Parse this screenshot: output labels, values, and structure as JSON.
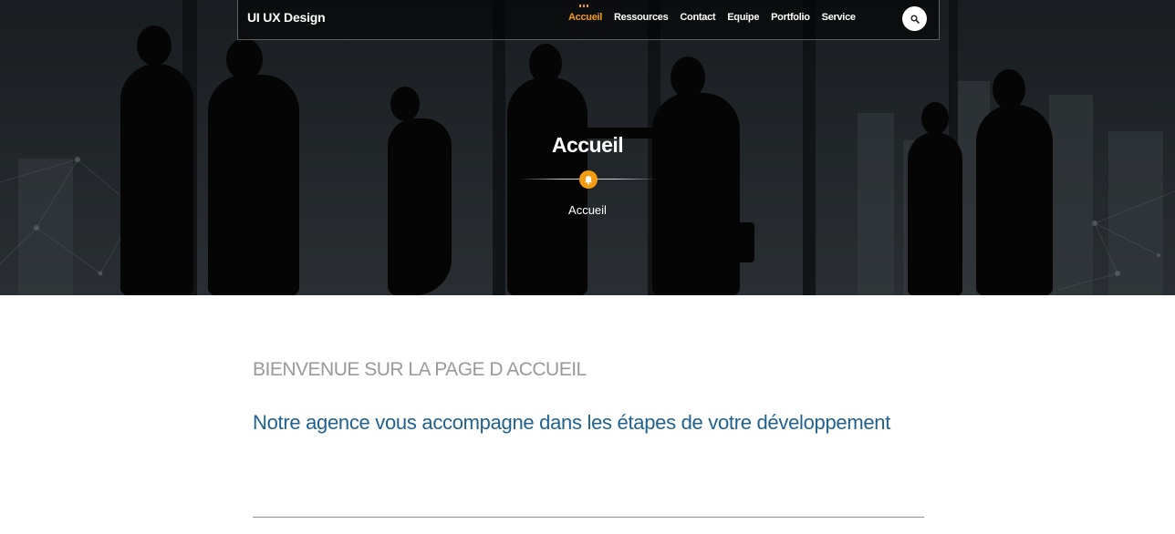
{
  "brand": "UI UX Design",
  "nav": {
    "items": [
      {
        "label": "Accueil",
        "active": true
      },
      {
        "label": "Ressources",
        "active": false
      },
      {
        "label": "Contact",
        "active": false
      },
      {
        "label": "Equipe",
        "active": false
      },
      {
        "label": "Portfolio",
        "active": false
      },
      {
        "label": "Service",
        "active": false
      }
    ],
    "search_icon": "search-icon"
  },
  "hero": {
    "title": "Accueil",
    "badge_icon": "bell-icon",
    "breadcrumb": "Accueil"
  },
  "content": {
    "heading": "BIENVENUE SUR LA PAGE D ACCUEIL",
    "subheading": "Notre agence vous accompagne dans les étapes de votre développement"
  },
  "colors": {
    "accent": "#f39c12",
    "heading_gray": "#9a9a9a",
    "subheading_blue": "#20628f"
  }
}
